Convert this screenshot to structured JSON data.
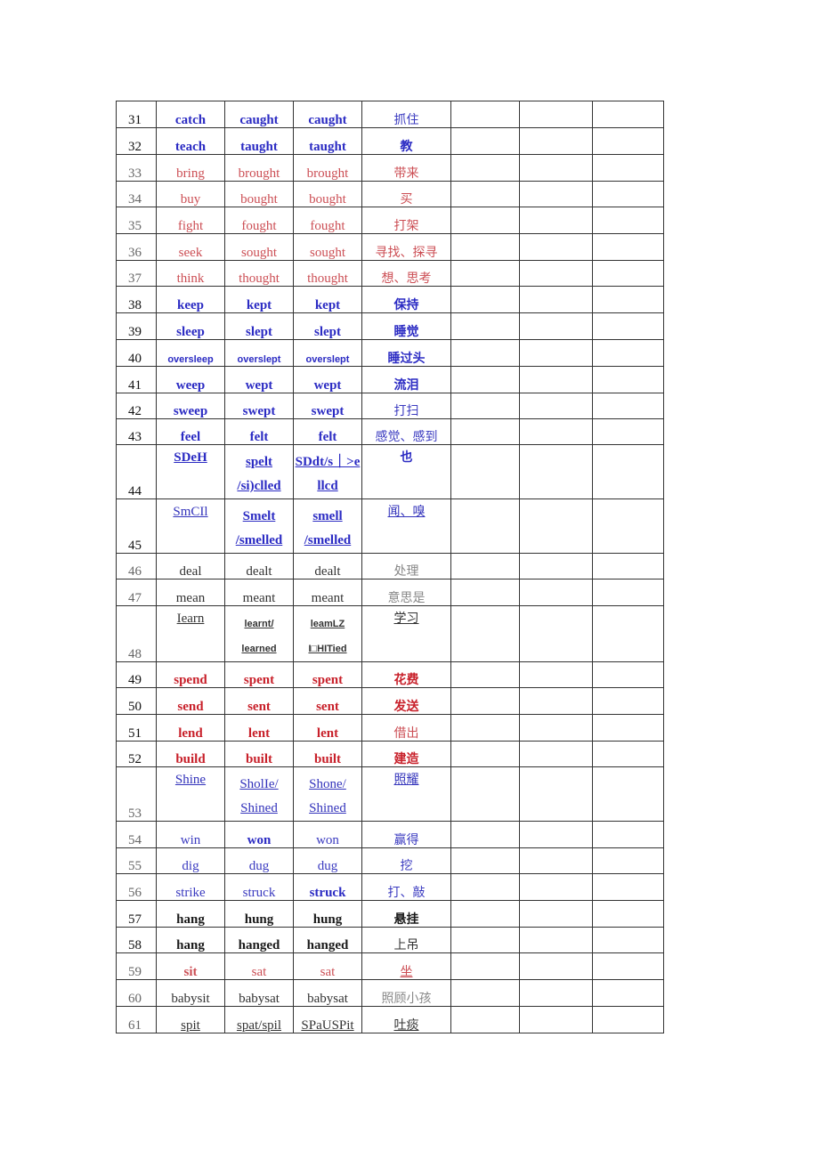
{
  "rows": [
    {
      "n": "31",
      "base": "catch",
      "past": "caught",
      "pp": "caught",
      "cn": "抓住"
    },
    {
      "n": "32",
      "base": "teach",
      "past": "taught",
      "pp": "taught",
      "cn": "教"
    },
    {
      "n": "33",
      "base": "bring",
      "past": "brought",
      "pp": "brought",
      "cn": "带来"
    },
    {
      "n": "34",
      "base": "buy",
      "past": "bought",
      "pp": "bought",
      "cn": "买"
    },
    {
      "n": "35",
      "base": "fight",
      "past": "fought",
      "pp": "fought",
      "cn": "打架"
    },
    {
      "n": "36",
      "base": "seek",
      "past": "sought",
      "pp": "sought",
      "cn": "寻找、探寻"
    },
    {
      "n": "37",
      "base": "think",
      "past": "thought",
      "pp": "thought",
      "cn": "想、思考"
    },
    {
      "n": "38",
      "base": "keep",
      "past": "kept",
      "pp": "kept",
      "cn": "保持"
    },
    {
      "n": "39",
      "base": "sleep",
      "past": "slept",
      "pp": "slept",
      "cn": "睡觉"
    },
    {
      "n": "40",
      "base": "oversleep",
      "past": "overslept",
      "pp": "overslept",
      "cn": "睡过头"
    },
    {
      "n": "41",
      "base": "weep",
      "past": "wept",
      "pp": "wept",
      "cn": "流泪"
    },
    {
      "n": "42",
      "base": "sweep",
      "past": "swept",
      "pp": "swept",
      "cn": "打扫"
    },
    {
      "n": "43",
      "base": "feel",
      "past": "felt",
      "pp": "felt",
      "cn": "感觉、感到"
    },
    {
      "n": "44",
      "base": "SDeH",
      "past_1": "spelt",
      "past_2": "/si)clled",
      "pp_1": "SDdt/s｜>e",
      "pp_2": "llcd",
      "cn": "也"
    },
    {
      "n": "45",
      "base": "SmCIl",
      "past_1": "Smelt",
      "past_2": "/smelled",
      "pp_1": "smell",
      "pp_2": "/smelled",
      "cn": "闻、嗅"
    },
    {
      "n": "46",
      "base": "deal",
      "past": "dealt",
      "pp": "dealt",
      "cn": "处理"
    },
    {
      "n": "47",
      "base": "mean",
      "past": "meant",
      "pp": "meant",
      "cn": "意思是"
    },
    {
      "n": "48",
      "base": "Iearn",
      "past_1": "learnt/",
      "past_2": "learned",
      "pp_1": "leamLZ",
      "pp_2": "I□HITied",
      "cn": "学习"
    },
    {
      "n": "49",
      "base": "spend",
      "past": "spent",
      "pp": "spent",
      "cn": "花费"
    },
    {
      "n": "50",
      "base": "send",
      "past": "sent",
      "pp": "sent",
      "cn": "发送"
    },
    {
      "n": "51",
      "base": "lend",
      "past": "lent",
      "pp": "lent",
      "cn": "借出"
    },
    {
      "n": "52",
      "base": "build",
      "past": "built",
      "pp": "built",
      "cn": "建造"
    },
    {
      "n": "53",
      "base": "Shine",
      "past_1": "SholIe/",
      "past_2": "Shined",
      "pp_1": "Shone/",
      "pp_2": "Shined",
      "cn": "照耀"
    },
    {
      "n": "54",
      "base": "win",
      "past": "won",
      "pp": "won",
      "cn": "赢得"
    },
    {
      "n": "55",
      "base": "dig",
      "past": "dug",
      "pp": "dug",
      "cn": "挖"
    },
    {
      "n": "56",
      "base": "strike",
      "past": "struck",
      "pp": "struck",
      "cn": "打、敲"
    },
    {
      "n": "57",
      "base": "hang",
      "past": "hung",
      "pp": "hung",
      "cn": "悬挂"
    },
    {
      "n": "58",
      "base": "hang",
      "past": "hanged",
      "pp": "hanged",
      "cn": "上吊"
    },
    {
      "n": "59",
      "base": "sit",
      "past": "sat",
      "pp": "sat",
      "cn": "坐"
    },
    {
      "n": "60",
      "base": "babysit",
      "past": "babysat",
      "pp": "babysat",
      "cn": "照顾小孩"
    },
    {
      "n": "61",
      "base": "spit",
      "past": "spat/spil",
      "pp": "SPaUSPit",
      "cn": "吐痰"
    }
  ]
}
